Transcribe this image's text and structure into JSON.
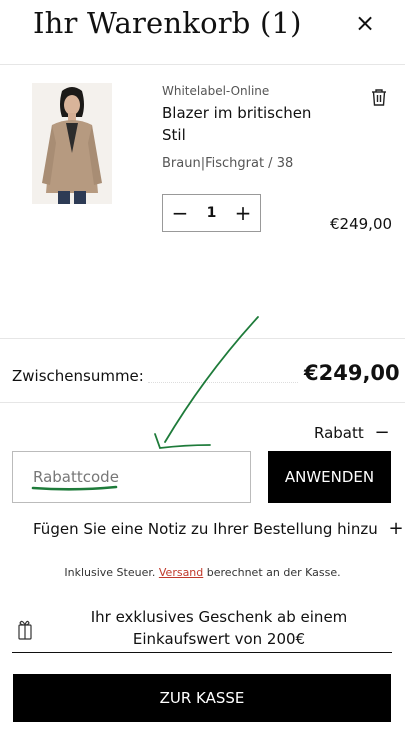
{
  "header": {
    "title": "Ihr Warenkorb (1)",
    "close_icon": "×"
  },
  "item": {
    "vendor": "Whitelabel-Online",
    "name": "Blazer im britischen Stil",
    "variant": "Braun|Fischgrat / 38",
    "quantity": "1",
    "minus": "−",
    "plus": "+",
    "price": "€249,00"
  },
  "summary": {
    "subtotal_label": "Zwischensumme:",
    "subtotal_value": "€249,00"
  },
  "discount": {
    "toggle_label": "Rabatt",
    "toggle_icon": "−",
    "placeholder": "Rabattcode",
    "apply_label": "ANWENDEN"
  },
  "note": {
    "label": "Fügen Sie eine Notiz zu Ihrer Bestellung hinzu",
    "icon": "+"
  },
  "tax": {
    "prefix": "Inklusive Steuer.",
    "link": "Versand",
    "suffix": "berechnet an der Kasse."
  },
  "gift": {
    "text": "Ihr exklusives Geschenk ab einem Einkaufswert von 200€",
    "progress": 0
  },
  "checkout": {
    "label": "ZUR KASSE"
  },
  "colors": {
    "annotation": "#1e7b3a",
    "button": "#000000",
    "link": "#c0392b"
  }
}
